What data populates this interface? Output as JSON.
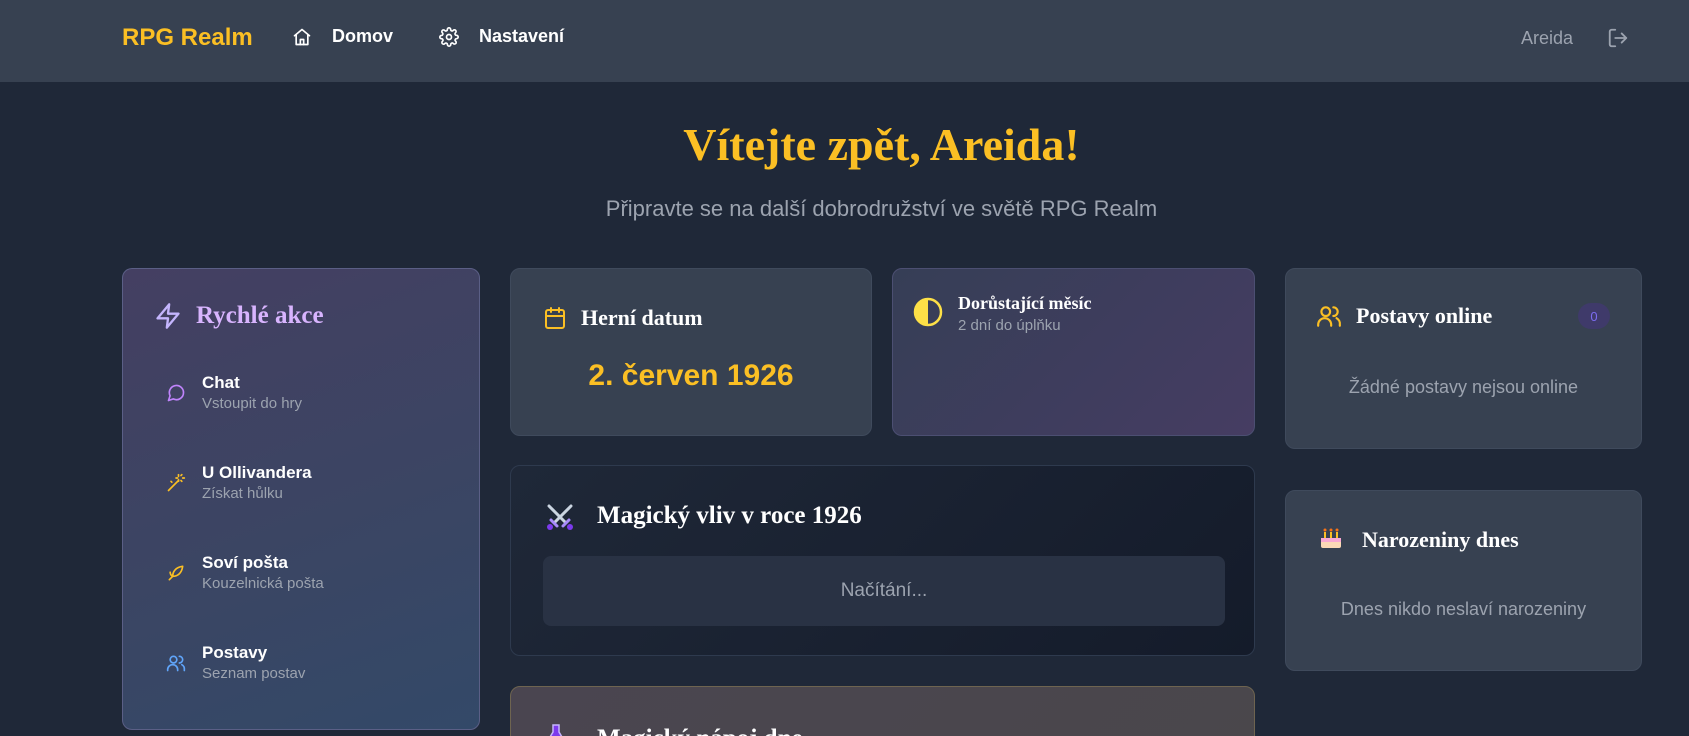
{
  "nav": {
    "brand": "RPG Realm",
    "home_label": "Domov",
    "settings_label": "Nastavení",
    "user": "Areida",
    "home_icon": "home-icon",
    "settings_icon": "gear-icon",
    "logout_icon": "logout-icon"
  },
  "hero": {
    "title": "Vítejte zpět, Areida!",
    "subtitle": "Připravte se na další dobrodružství ve světě RPG Realm"
  },
  "quick_actions": {
    "title": "Rychlé akce",
    "items": [
      {
        "label": "Chat",
        "sub": "Vstoupit do hry",
        "icon": "chat-bubble-icon"
      },
      {
        "label": "U Ollivandera",
        "sub": "Získat hůlku",
        "icon": "magic-wand-icon"
      },
      {
        "label": "Soví pošta",
        "sub": "Kouzelnická pošta",
        "icon": "bird-icon"
      },
      {
        "label": "Postavy",
        "sub": "Seznam postav",
        "icon": "users-icon"
      }
    ]
  },
  "game_date": {
    "title": "Herní datum",
    "value": "2. červen 1926",
    "icon": "calendar-icon"
  },
  "moon": {
    "title": "Dorůstající měsíc",
    "sub": "2 dní do úplňku",
    "icon": "half-moon-icon"
  },
  "magic_influence": {
    "title": "Magický vliv v roce 1926",
    "loading": "Načítání...",
    "icon": "crossed-swords-icon"
  },
  "potion": {
    "title": "Magický nápoj dne",
    "icon": "potion-icon"
  },
  "online": {
    "title": "Postavy online",
    "count": "0",
    "empty": "Žádné postavy nejsou online",
    "icon": "users-icon"
  },
  "birthdays": {
    "title": "Narozeniny dnes",
    "empty": "Dnes nikdo neslaví narozeniny",
    "icon": "birthday-cake-icon"
  },
  "colors": {
    "accent": "#fbbf24",
    "background": "#1f2838",
    "card": "#374151",
    "purple": "#d8b4fe"
  }
}
